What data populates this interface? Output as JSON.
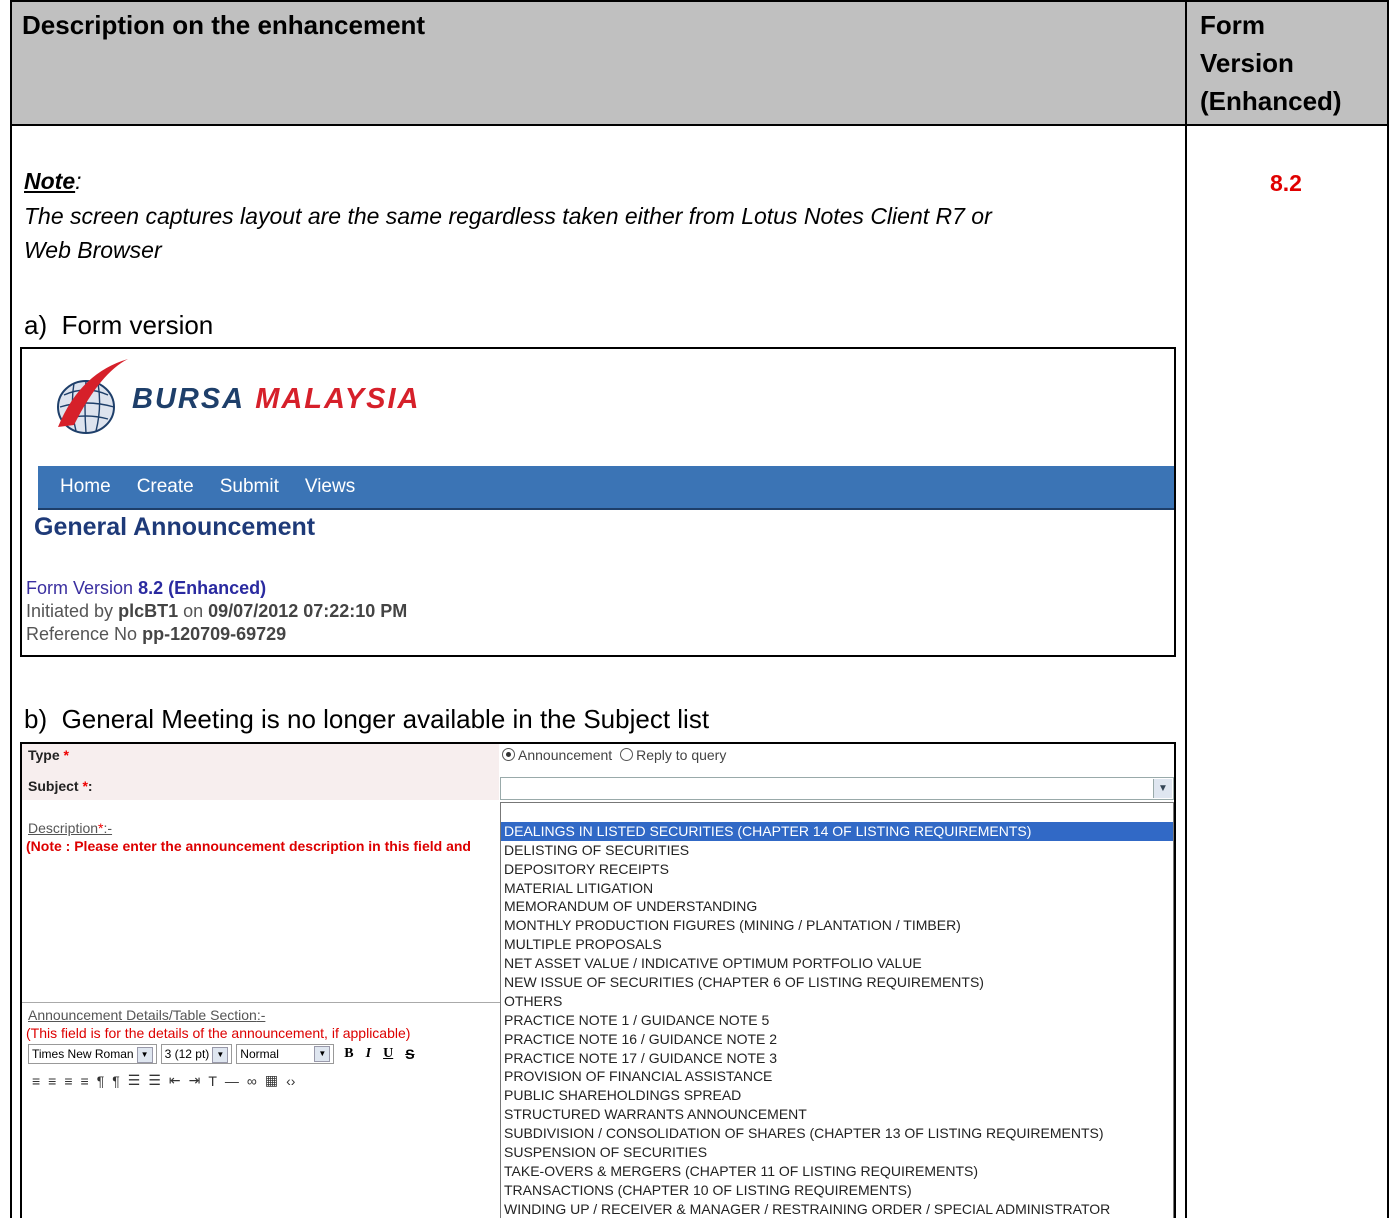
{
  "table": {
    "col1_header": "Description on the enhancement",
    "col2_header": [
      "Form",
      "Version",
      "(Enhanced)"
    ],
    "version_value": "8.2"
  },
  "note": {
    "label": "Note",
    "colon": ":",
    "text_line1": "The screen captures layout are the same regardless taken either from Lotus Notes Client R7 or",
    "text_line2": "Web Browser"
  },
  "section_a": {
    "title": "a)  Form version"
  },
  "section_b": {
    "title": "b)  General Meeting is no longer available in the Subject list"
  },
  "screenshot_a": {
    "logo_text_1": "BURSA",
    "logo_text_2": "MALAYSIA",
    "nav": [
      "Home",
      "Create",
      "Submit",
      "Views"
    ],
    "page_title": "General Announcement",
    "form_version_label": "Form Version",
    "form_version_value": "8.2 (Enhanced)",
    "initiated_by_label": "Initiated by",
    "initiated_by_user": "plcBT1",
    "initiated_on_label": "on",
    "initiated_on_value": "09/07/2012 07:22:10 PM",
    "reference_label": "Reference No",
    "reference_value": "pp-120709-69729"
  },
  "screenshot_b": {
    "type_label": "Type",
    "subject_label": "Subject",
    "required_mark": "*",
    "subject_colon": ":",
    "radio_announcement": "Announcement",
    "radio_reply": "Reply to query",
    "description_label": "Description",
    "description_suffix": ":-",
    "description_note": "(Note : Please enter the announcement description in this field and",
    "details_label": "Announcement Details/Table Section",
    "details_suffix": ":-",
    "details_note": "(This field is for the details of the announcement, if applicable)",
    "toolbar": {
      "font": "Times New Roman",
      "size": "3 (12 pt)",
      "style": "Normal"
    },
    "subject_options": [
      "DEALINGS IN LISTED SECURITIES (CHAPTER 14 OF LISTING REQUIREMENTS)",
      "DELISTING OF SECURITIES",
      "DEPOSITORY RECEIPTS",
      "MATERIAL LITIGATION",
      "MEMORANDUM OF UNDERSTANDING",
      "MONTHLY PRODUCTION FIGURES (MINING / PLANTATION / TIMBER)",
      "MULTIPLE PROPOSALS",
      "NET ASSET VALUE / INDICATIVE OPTIMUM PORTFOLIO VALUE",
      "NEW ISSUE OF SECURITIES (CHAPTER 6 OF LISTING REQUIREMENTS)",
      "OTHERS",
      "PRACTICE NOTE 1 / GUIDANCE NOTE 5",
      "PRACTICE NOTE 16 / GUIDANCE NOTE 2",
      "PRACTICE NOTE 17 / GUIDANCE NOTE 3",
      "PROVISION OF FINANCIAL ASSISTANCE",
      "PUBLIC SHAREHOLDINGS SPREAD",
      "STRUCTURED WARRANTS ANNOUNCEMENT",
      "SUBDIVISION / CONSOLIDATION OF SHARES (CHAPTER 13 OF LISTING REQUIREMENTS)",
      "SUSPENSION OF SECURITIES",
      "TAKE-OVERS & MERGERS (CHAPTER 11 OF LISTING REQUIREMENTS)",
      "TRANSACTIONS (CHAPTER 10 OF LISTING REQUIREMENTS)",
      "WINDING UP / RECEIVER & MANAGER / RESTRAINING ORDER / SPECIAL ADMINISTRATOR"
    ],
    "highlight_color": "#3169c6"
  },
  "colors": {
    "header_bg": "#c0c0c0",
    "version_red": "#e00000",
    "nav_blue": "#3b74b5",
    "title_navy": "#1e3a78"
  }
}
